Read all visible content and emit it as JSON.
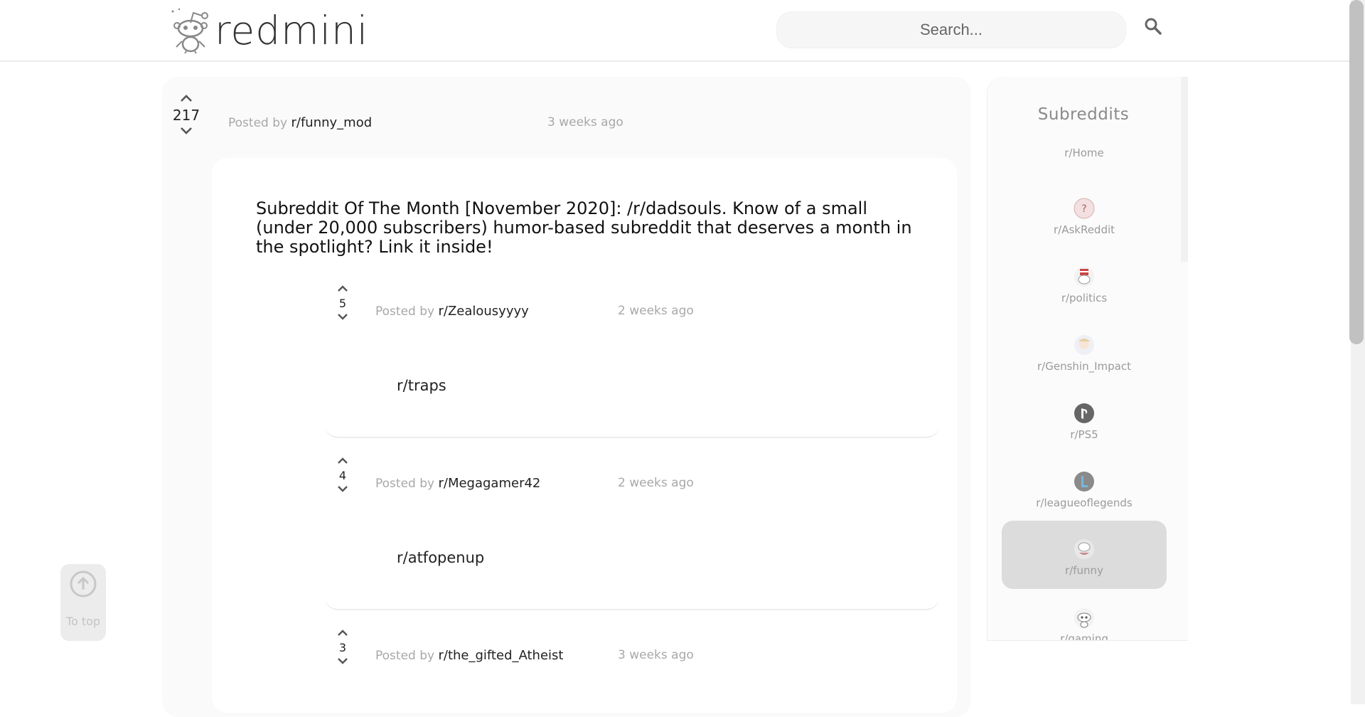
{
  "header": {
    "logo_text": "redmini",
    "search_placeholder": "Search..."
  },
  "post": {
    "votes": "217",
    "posted_by_prefix": "Posted by",
    "author": "r/funny_mod",
    "time": "3 weeks ago",
    "title": "Subreddit Of The Month [November 2020]: /r/dadsouls. Know of a small (under 20,000 subscribers) humor-based subreddit that deserves a month in the spotlight? Link it inside!"
  },
  "comments": [
    {
      "votes": "5",
      "posted_by_prefix": "Posted by",
      "author": "r/Zealousyyyy",
      "time": "2 weeks ago",
      "body": "r/traps"
    },
    {
      "votes": "4",
      "posted_by_prefix": "Posted by",
      "author": "r/Megagamer42",
      "time": "2 weeks ago",
      "body": "r/atfopenup"
    },
    {
      "votes": "3",
      "posted_by_prefix": "Posted by",
      "author": "r/the_gifted_Atheist",
      "time": "3 weeks ago",
      "body": ""
    }
  ],
  "sidebar": {
    "title": "Subreddits",
    "items": [
      {
        "label": "r/Home",
        "icon": "none"
      },
      {
        "label": "r/AskReddit",
        "icon": "askreddit-icon"
      },
      {
        "label": "r/politics",
        "icon": "politics-icon"
      },
      {
        "label": "r/Genshin_Impact",
        "icon": "genshin-icon"
      },
      {
        "label": "r/PS5",
        "icon": "playstation-icon"
      },
      {
        "label": "r/leagueoflegends",
        "icon": "league-icon"
      },
      {
        "label": "r/funny",
        "icon": "funny-icon",
        "active": true
      },
      {
        "label": "r/gaming",
        "icon": "snoo-icon"
      }
    ]
  },
  "to_top": {
    "label": "To top"
  },
  "colors": {
    "accent_active": "#dcdcdc",
    "muted_text": "#a8a8a8"
  }
}
